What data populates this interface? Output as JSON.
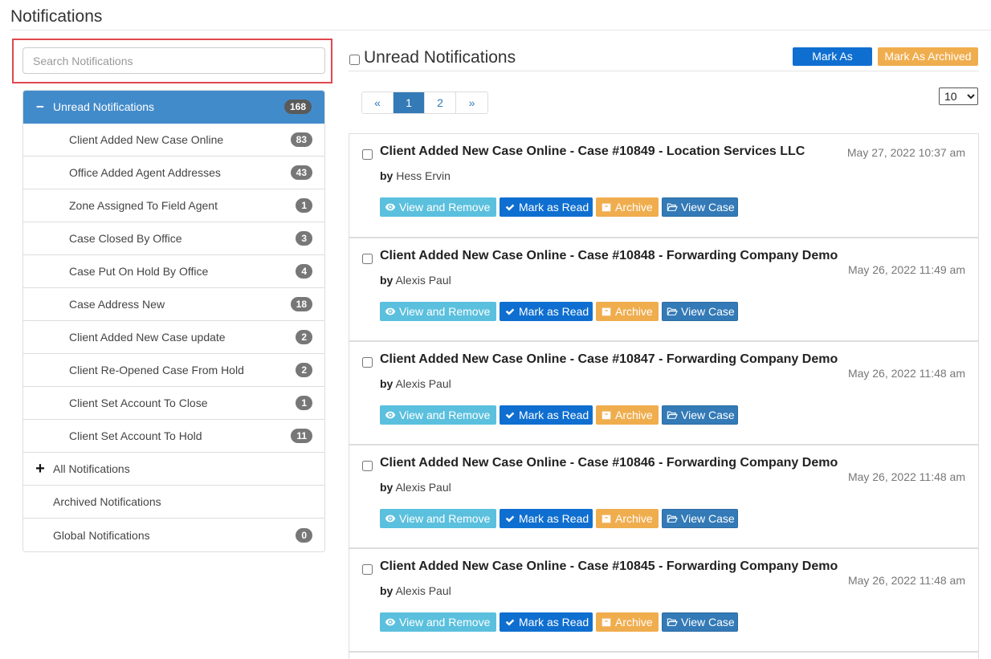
{
  "page": {
    "title": "Notifications"
  },
  "search": {
    "placeholder": "Search Notifications"
  },
  "sidebar": {
    "items": [
      {
        "label": "Unread Notifications",
        "count": "168",
        "expanded": true
      },
      {
        "label": "Client Added New Case Online",
        "count": "83"
      },
      {
        "label": "Office Added Agent Addresses",
        "count": "43"
      },
      {
        "label": "Zone Assigned To Field Agent",
        "count": "1"
      },
      {
        "label": "Case Closed By Office",
        "count": "3"
      },
      {
        "label": "Case Put On Hold By Office",
        "count": "4"
      },
      {
        "label": "Case Address New",
        "count": "18"
      },
      {
        "label": "Client Added New Case update",
        "count": "2"
      },
      {
        "label": "Client Re-Opened Case From Hold",
        "count": "2"
      },
      {
        "label": "Client Set Account To Close",
        "count": "1"
      },
      {
        "label": "Client Set Account To Hold",
        "count": "11"
      },
      {
        "label": "All Notifications",
        "collapsed": true
      },
      {
        "label": "Archived Notifications"
      },
      {
        "label": "Global Notifications",
        "count": "0"
      }
    ],
    "expand_symbol": "−",
    "collapse_symbol": "+"
  },
  "main": {
    "title": "Unread Notifications",
    "mark_all_read_label": "Mark As Read",
    "mark_all_archived_label": "Mark As Archived",
    "pagination": {
      "prev": "«",
      "pages": [
        "1",
        "2"
      ],
      "current": "1",
      "next": "»"
    },
    "page_size": {
      "selected": "10"
    },
    "actions": {
      "view_remove": "View and Remove",
      "mark_read": "Mark as Read",
      "archive": "Archive",
      "view_case": "View Case"
    },
    "by_label": "by",
    "notifications": [
      {
        "title": "Client Added New Case Online - Case #10849 - Location Services LLC",
        "author": "Hess Ervin",
        "date": "May 27, 2022 10:37 am"
      },
      {
        "title": "Client Added New Case Online - Case #10848 - Forwarding Company Demo",
        "author": "Alexis Paul",
        "date": "May 26, 2022 11:49 am"
      },
      {
        "title": "Client Added New Case Online - Case #10847 - Forwarding Company Demo",
        "author": "Alexis Paul",
        "date": "May 26, 2022 11:48 am"
      },
      {
        "title": "Client Added New Case Online - Case #10846 - Forwarding Company Demo",
        "author": "Alexis Paul",
        "date": "May 26, 2022 11:48 am"
      },
      {
        "title": "Client Added New Case Online - Case #10845 - Forwarding Company Demo",
        "author": "Alexis Paul",
        "date": "May 26, 2022 11:48 am"
      }
    ]
  },
  "colors": {
    "active_item": "#428bca",
    "badge": "#777777",
    "primary": "#0f6fd0",
    "warning": "#f0ad4e",
    "info": "#5bc0de",
    "case_button": "#337ab7",
    "highlight": "#e0484f"
  },
  "icons": {
    "view_remove": "eye-icon",
    "mark_read": "check-icon",
    "archive": "archive-box-icon",
    "view_case": "folder-open-icon"
  }
}
